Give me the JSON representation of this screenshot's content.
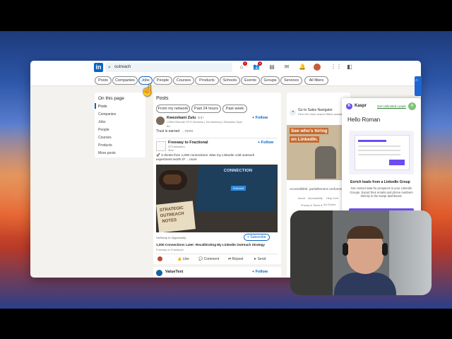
{
  "search": {
    "value": "outreach"
  },
  "filters": [
    "Posts",
    "Companies",
    "Jobs",
    "People",
    "Courses",
    "Products",
    "Schools",
    "Events",
    "Groups",
    "Services",
    "All filters"
  ],
  "sidebar": {
    "title": "On this page",
    "items": [
      "Posts",
      "Companies",
      "Jobs",
      "People",
      "Courses",
      "Products",
      "More posts"
    ]
  },
  "feed": {
    "header": "Posts",
    "chips": [
      "From my network",
      "Past 24 hours",
      "Past week"
    ],
    "post1": {
      "author": "Kwezekani Zulu",
      "degree": "· 3rd+",
      "headline": "I Offer Remote CFO Services | Tax Advisory | Business Syst...",
      "time": "6d ·",
      "follow": "+ Follow",
      "text": "Trust is earned",
      "more": "…more"
    },
    "post2": {
      "author": "Freeway to Fractional",
      "sub": "373 followers",
      "time": "3mo ·",
      "follow": "+ Follow",
      "text1": "🚀 3 clients from 1,000 connections: Was my LinkedIn cold outreach",
      "text2": "experiment worth it? …more",
      "image_words": {
        "screen_title": "CONNECTION",
        "screen_btn": "Connect",
        "notebook_l1": "STRATEGIC",
        "notebook_l2": "OUTREACH",
        "notebook_l3": "NOTES"
      },
      "source": "OnRamp to Opportunity",
      "subscribe": "+ Subscribe",
      "article": "1,000 Connections Later: Recalibrating My LinkedIn Outreach Strategy",
      "article_by": "Freeway to Fractional"
    },
    "actions": [
      "Like",
      "Comment",
      "Repost",
      "Send"
    ],
    "post3": {
      "author": "ValueText",
      "follow": "+ Follow"
    }
  },
  "right": {
    "title": "Go to Sales Navigator",
    "sub": "Find 10x more search filters available",
    "ad_text1": "See who's hiring",
    "ad_text2": "on LinkedIn.",
    "acc": "Accessibilité: partiellement conforme",
    "footer": [
      "About",
      "Accessibility",
      "Help Cent",
      "Privacy & Terms ▾",
      "Ad Choice",
      "Advertising",
      "Business Services ▾"
    ]
  },
  "kaspr": {
    "brand": "Kaspr",
    "link": "Get Unlimited Leads",
    "avatar": "R",
    "hello": "Hello Roman",
    "title": "Enrich leads from a LinkedIn Group",
    "body": "Get contact data for prospects in your LinkedIn Groups. Export their emails and phone numbers directly to the Kaspr dashboard."
  }
}
